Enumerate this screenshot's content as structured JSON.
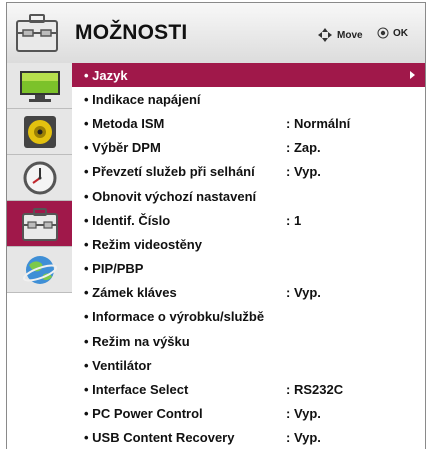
{
  "header": {
    "title": "MOŽNOSTI",
    "move_label": "Move",
    "ok_label": "OK",
    "icon": "toolbox-icon"
  },
  "sidebar": {
    "items": [
      {
        "icon": "picture-monitor-icon",
        "active": false
      },
      {
        "icon": "audio-speaker-icon",
        "active": false
      },
      {
        "icon": "clock-icon",
        "active": false
      },
      {
        "icon": "toolbox-icon",
        "active": true
      },
      {
        "icon": "network-globe-icon",
        "active": false
      }
    ]
  },
  "menu": {
    "items": [
      {
        "label": "• Jazyk",
        "value": "",
        "selected": true
      },
      {
        "label": "• Indikace napájení",
        "value": ""
      },
      {
        "label": "• Metoda ISM",
        "value": ": Normální"
      },
      {
        "label": "• Výběr DPM",
        "value": ": Zap."
      },
      {
        "label": "• Převzetí služeb při selhání",
        "value": ": Vyp."
      },
      {
        "label": "• Obnovit výchozí nastavení",
        "value": ""
      },
      {
        "label": "• Identif. Číslo",
        "value": ": 1"
      },
      {
        "label": "• Režim videostěny",
        "value": ""
      },
      {
        "label": "• PIP/PBP",
        "value": ""
      },
      {
        "label": "• Zámek kláves",
        "value": ": Vyp."
      },
      {
        "label": "• Informace o výrobku/službě",
        "value": ""
      },
      {
        "label": "• Režim na výšku",
        "value": ""
      },
      {
        "label": "• Ventilátor",
        "value": ""
      },
      {
        "label": "• Interface Select",
        "value": ": RS232C"
      },
      {
        "label": "• PC Power Control",
        "value": ": Vyp."
      },
      {
        "label": "• USB Content Recovery",
        "value": ": Vyp."
      }
    ]
  },
  "colors": {
    "accent": "#a0184a"
  }
}
